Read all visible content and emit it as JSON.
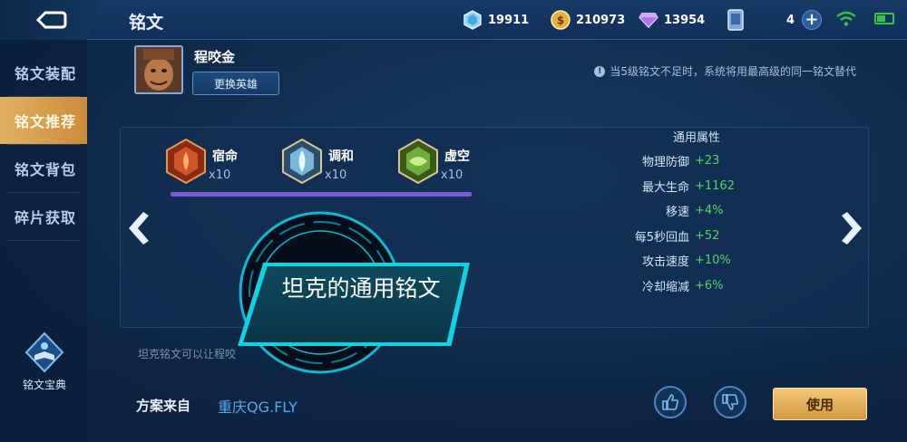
{
  "header": {
    "title": "铭文",
    "resources": {
      "diamonds": "19911",
      "gold": "210973",
      "gems": "13954",
      "tickets": "4"
    }
  },
  "sidebar": {
    "items": [
      {
        "label": "铭文装配",
        "active": false
      },
      {
        "label": "铭文推荐",
        "active": true
      },
      {
        "label": "铭文背包",
        "active": false
      },
      {
        "label": "碎片获取",
        "active": false
      }
    ],
    "codex_label": "铭文宝典"
  },
  "hero": {
    "name": "程咬金",
    "change_button": "更换英雄"
  },
  "tip": "当5级铭文不足时，系统将用最高级的同一铭文替代",
  "runes": [
    {
      "name": "宿命",
      "count": "x10",
      "color": "#d0542a"
    },
    {
      "name": "调和",
      "count": "x10",
      "color": "#7ab6d8"
    },
    {
      "name": "虚空",
      "count": "x10",
      "color": "#6fae3a"
    }
  ],
  "stats": {
    "title": "通用属性",
    "rows": [
      {
        "name": "物理防御",
        "value": "+23"
      },
      {
        "name": "最大生命",
        "value": "+1162"
      },
      {
        "name": "移速",
        "value": "+4%"
      },
      {
        "name": "每5秒回血",
        "value": "+52"
      },
      {
        "name": "攻击速度",
        "value": "+10%"
      },
      {
        "name": "冷却缩减",
        "value": "+6%"
      }
    ]
  },
  "banner": "坦克的通用铭文",
  "description": "坦克铭文可以让程咬",
  "footer": {
    "source_label": "方案来自",
    "source_value": "重庆QG.FLY",
    "use_button": "使用"
  },
  "colors": {
    "accent_gold": "#e3b061",
    "stat_green": "#53d65f",
    "banner_cyan": "#0ed3e3",
    "purple_bar": "#7a5bd6"
  }
}
